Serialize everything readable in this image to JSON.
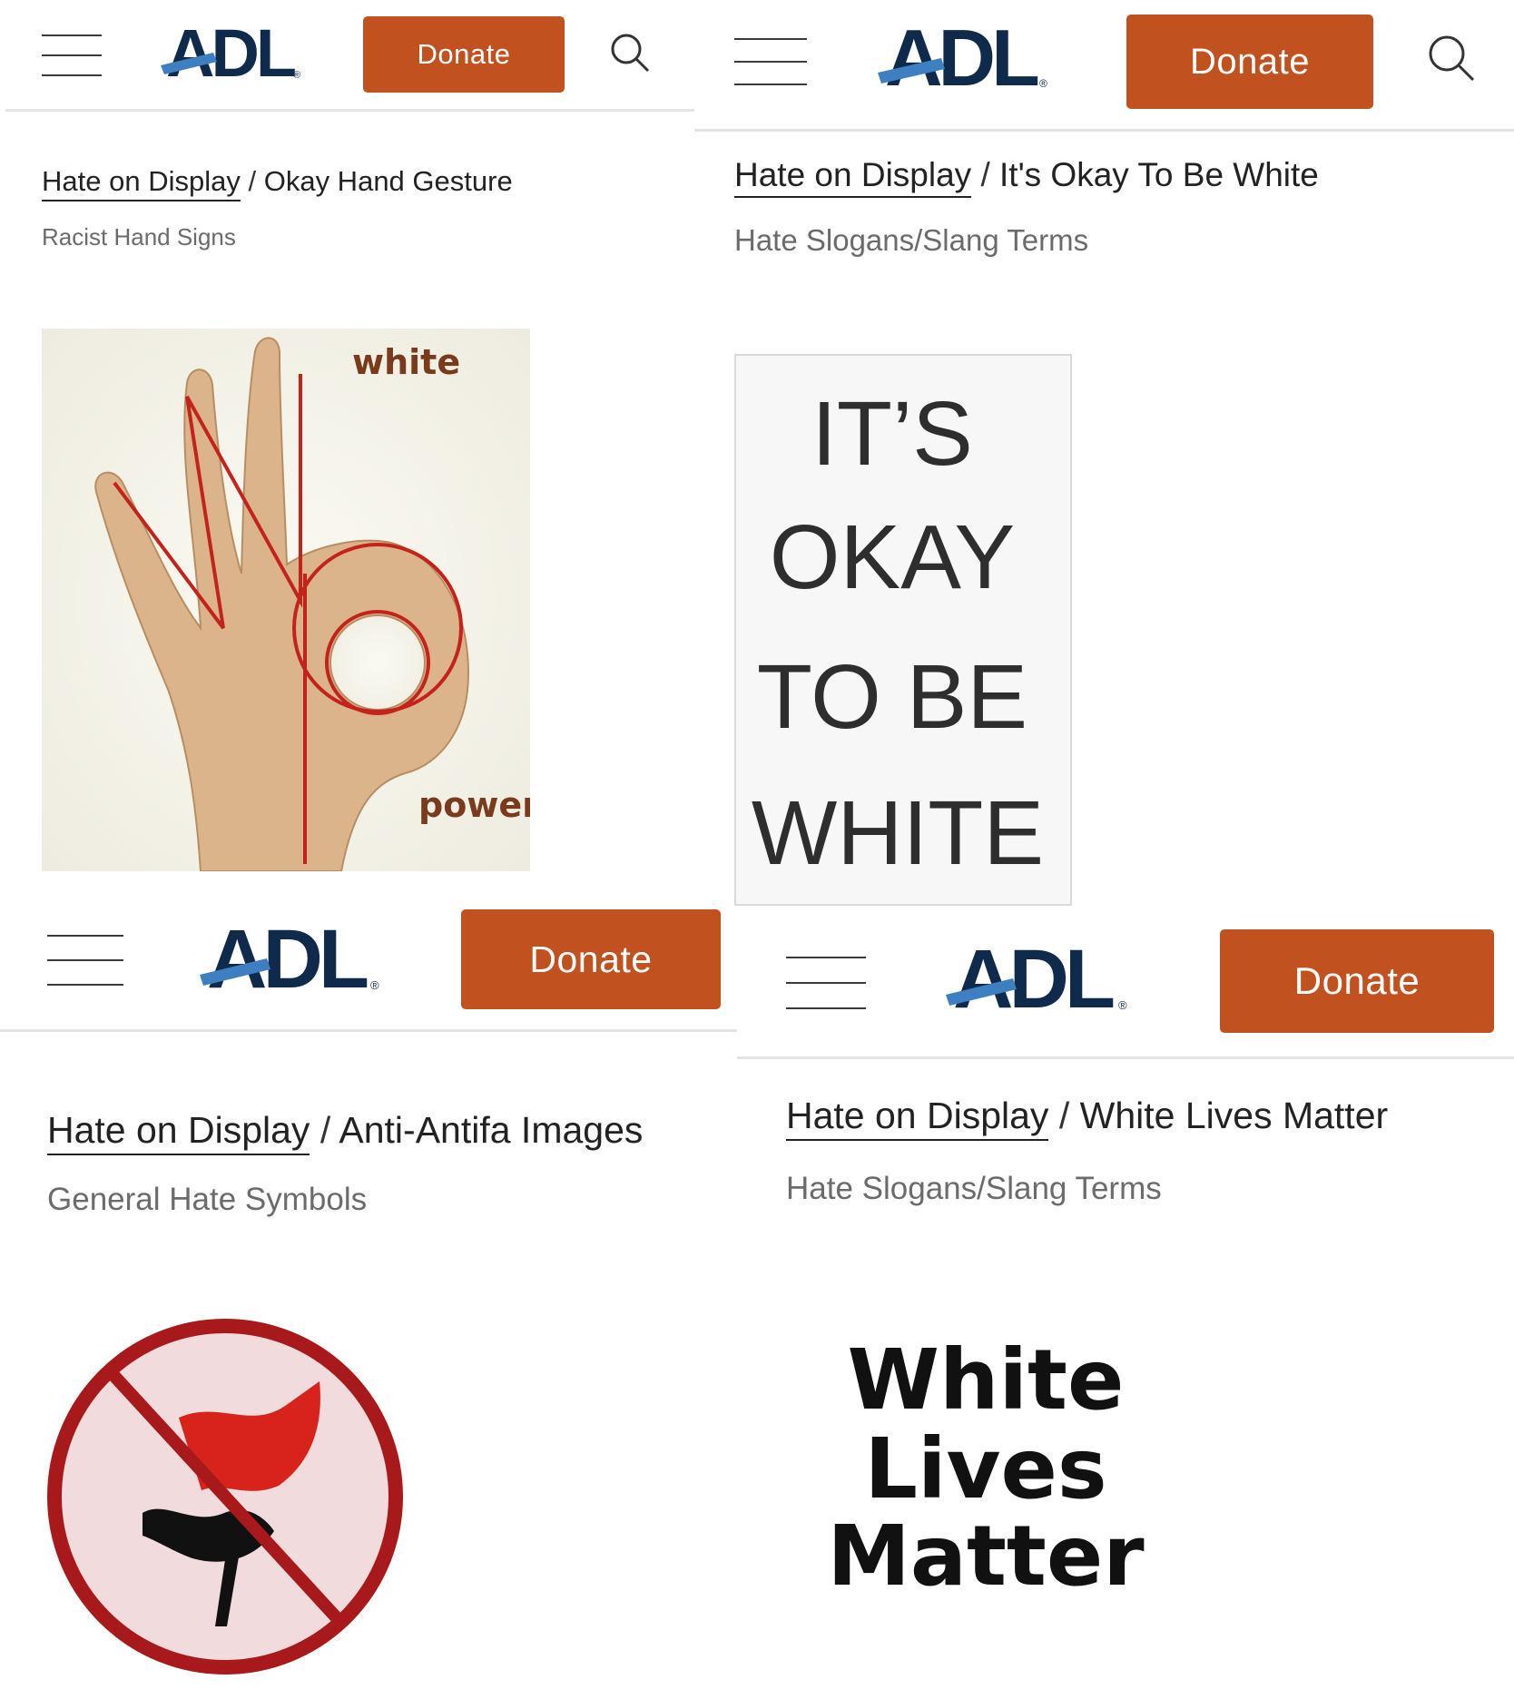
{
  "brand": {
    "logo_text": "ADL",
    "registered": "®"
  },
  "colors": {
    "accent": "#c1511f",
    "logo_navy": "#0f2a4a",
    "logo_blue": "#3d7fc1",
    "slash_red": "#c4231c"
  },
  "icons": {
    "menu": "hamburger-menu-icon",
    "search": "search-icon"
  },
  "panels": [
    {
      "donate_label": "Donate",
      "breadcrumb_root": "Hate on Display",
      "breadcrumb_sep": "/",
      "breadcrumb_page": "Okay Hand Gesture",
      "category": "Racist Hand Signs",
      "image": {
        "subject": "okay-hand-gesture",
        "label_top": "white",
        "label_bottom": "power"
      }
    },
    {
      "donate_label": "Donate",
      "breadcrumb_root": "Hate on Display",
      "breadcrumb_sep": "/",
      "breadcrumb_page": "It's Okay To Be White",
      "category": "Hate Slogans/Slang Terms",
      "image": {
        "lines": [
          "IT’S",
          "OKAY",
          "TO BE",
          "WHITE"
        ]
      }
    },
    {
      "donate_label": "Donate",
      "breadcrumb_root": "Hate on Display",
      "breadcrumb_sep": "/",
      "breadcrumb_page": "Anti-Antifa Images",
      "category": "General Hate Symbols",
      "image": {
        "subject": "crossed-out-antifa-flag"
      }
    },
    {
      "donate_label": "Donate",
      "breadcrumb_root": "Hate on Display",
      "breadcrumb_sep": "/",
      "breadcrumb_page": "White Lives Matter",
      "category": "Hate Slogans/Slang Terms",
      "image": {
        "lines": [
          "White",
          "Lives",
          "Matter"
        ]
      }
    }
  ]
}
